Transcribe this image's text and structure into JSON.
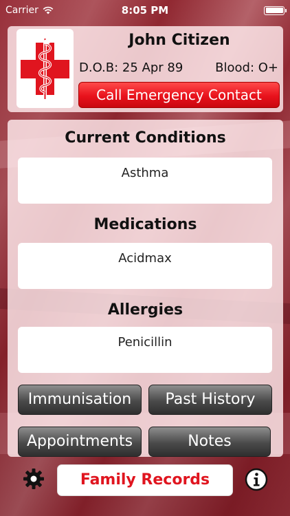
{
  "status_bar": {
    "carrier": "Carrier",
    "time": "8:05 PM"
  },
  "profile": {
    "name": "John Citizen",
    "dob_label": "D.O.B:",
    "dob_value": "25 Apr 89",
    "blood_label": "Blood:",
    "blood_value": "O+",
    "call_button_label": "Call Emergency Contact",
    "logo_icon": "medical-cross-rod-of-asclepius-icon"
  },
  "sections": {
    "conditions": {
      "title": "Current Conditions",
      "value": "Asthma"
    },
    "medications": {
      "title": "Medications",
      "value": "Acidmax"
    },
    "allergies": {
      "title": "Allergies",
      "value": "Penicillin"
    }
  },
  "buttons": {
    "immunisation": "Immunisation",
    "past_history": "Past History",
    "appointments": "Appointments",
    "notes": "Notes"
  },
  "bottom_bar": {
    "family_records_label": "Family Records",
    "settings_icon": "gear-icon",
    "info_icon": "info-icon"
  },
  "colors": {
    "accent_red": "#e8121c",
    "button_grey": "#4a4a4a",
    "panel_bg": "#ffebee"
  }
}
